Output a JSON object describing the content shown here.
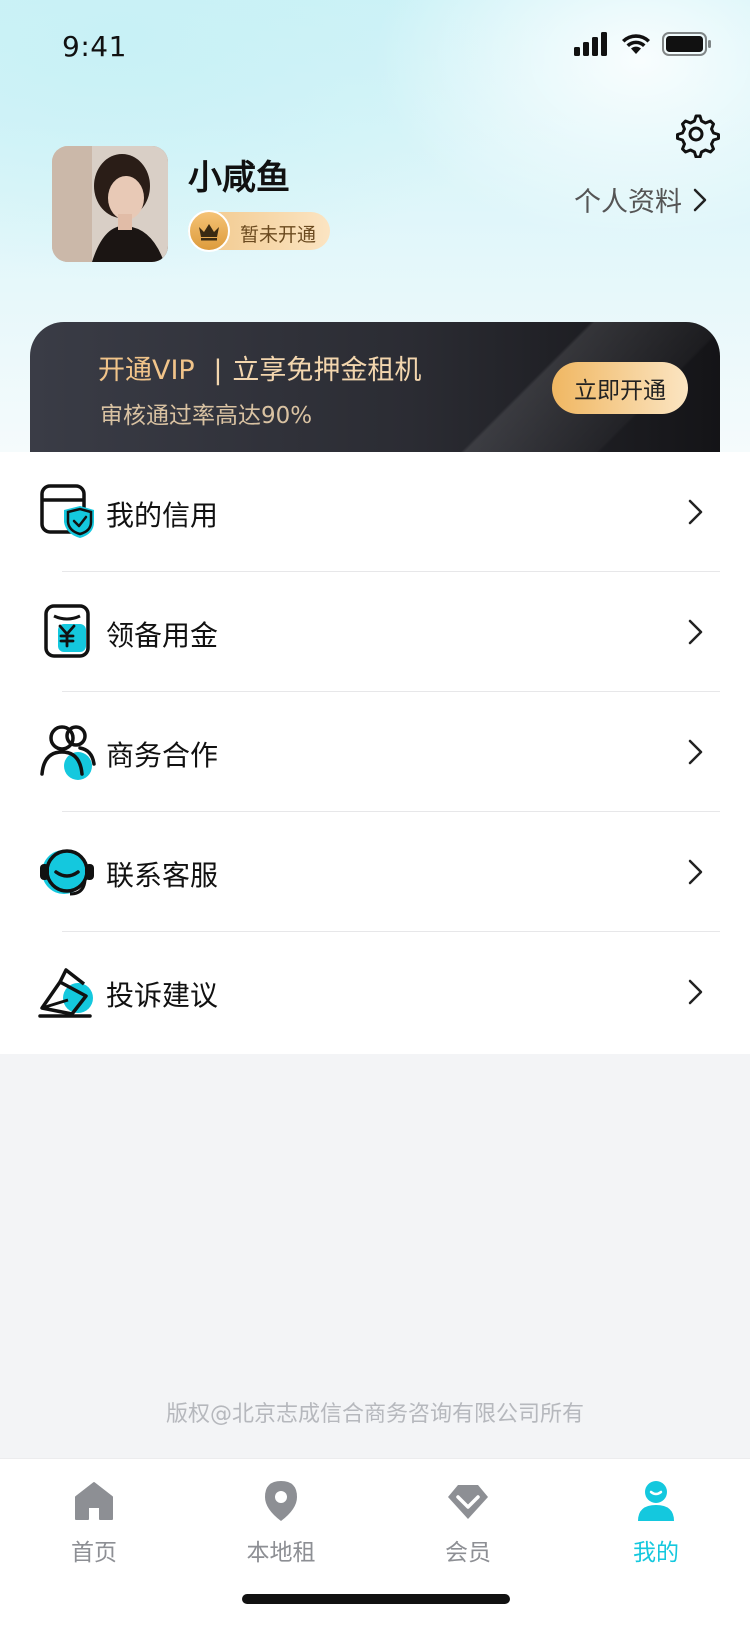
{
  "status_bar": {
    "time": "9:41"
  },
  "profile": {
    "username": "小咸鱼",
    "membership_status": "暂未开通",
    "profile_link": "个人资料"
  },
  "vip_banner": {
    "title_highlight": "开通VIP",
    "title_separator": "|",
    "title_rest": "立享免押金租机",
    "subtitle": "审核通过率高达90%",
    "button": "立即开通"
  },
  "menu": {
    "items": [
      {
        "label": "我的信用",
        "icon": "credit-card-shield-icon"
      },
      {
        "label": "领备用金",
        "icon": "yuan-wallet-icon"
      },
      {
        "label": "商务合作",
        "icon": "business-people-icon"
      },
      {
        "label": "联系客服",
        "icon": "headset-agent-icon"
      },
      {
        "label": "投诉建议",
        "icon": "envelope-feedback-icon"
      }
    ]
  },
  "footer": {
    "copyright": "版权@北京志成信合商务咨询有限公司所有"
  },
  "tab_bar": {
    "tabs": [
      {
        "label": "首页",
        "icon": "home-icon",
        "active": false
      },
      {
        "label": "本地租",
        "icon": "location-pin-icon",
        "active": false
      },
      {
        "label": "会员",
        "icon": "diamond-icon",
        "active": false
      },
      {
        "label": "我的",
        "icon": "user-icon",
        "active": true
      }
    ]
  },
  "colors": {
    "accent": "#14c8de",
    "vip_gold": "#f1c48a",
    "banner_dark": "#2b2c33"
  }
}
